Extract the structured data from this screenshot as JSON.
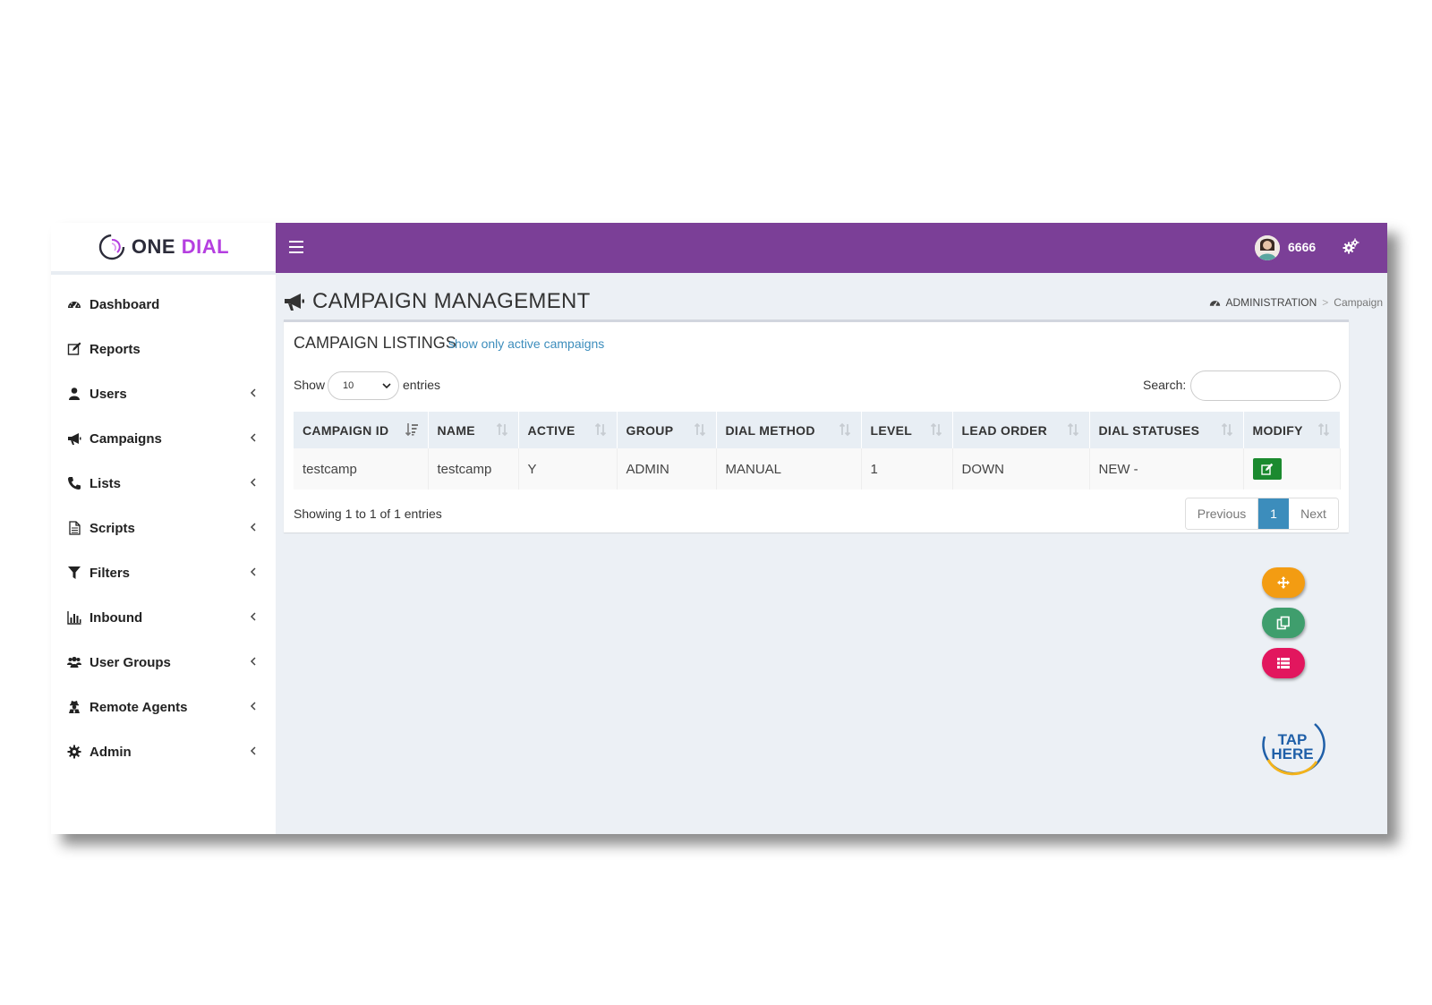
{
  "brand": {
    "one": "ONE",
    "dial": "DIAL"
  },
  "sidebar": {
    "items": [
      {
        "label": "Dashboard",
        "icon": "dashboard-icon",
        "has_children": false
      },
      {
        "label": "Reports",
        "icon": "edit-icon",
        "has_children": false
      },
      {
        "label": "Users",
        "icon": "user-icon",
        "has_children": true
      },
      {
        "label": "Campaigns",
        "icon": "bullhorn-icon",
        "has_children": true
      },
      {
        "label": "Lists",
        "icon": "phone-icon",
        "has_children": true
      },
      {
        "label": "Scripts",
        "icon": "file-icon",
        "has_children": true
      },
      {
        "label": "Filters",
        "icon": "filter-icon",
        "has_children": true
      },
      {
        "label": "Inbound",
        "icon": "bar-chart-icon",
        "has_children": true
      },
      {
        "label": "User Groups",
        "icon": "users-icon",
        "has_children": true
      },
      {
        "label": "Remote Agents",
        "icon": "user-secret-icon",
        "has_children": true
      },
      {
        "label": "Admin",
        "icon": "gear-icon",
        "has_children": true
      }
    ]
  },
  "topbar": {
    "user_name": "6666"
  },
  "page": {
    "title": "CAMPAIGN MANAGEMENT",
    "breadcrumb": {
      "root": "ADMINISTRATION",
      "separator": ">",
      "current": "Campaign"
    }
  },
  "box": {
    "title": "CAMPAIGN LISTINGS",
    "link": "show only active campaigns",
    "length_label_before": "Show",
    "length_value": "10",
    "length_label_after": "entries",
    "search_label": "Search:",
    "search_value": ""
  },
  "table": {
    "columns": [
      "CAMPAIGN ID",
      "NAME",
      "ACTIVE",
      "GROUP",
      "DIAL METHOD",
      "LEVEL",
      "LEAD ORDER",
      "DIAL STATUSES",
      "MODIFY"
    ],
    "rows": [
      {
        "campaign_id": "testcamp",
        "name": "testcamp",
        "active": "Y",
        "group": "ADMIN",
        "dial_method": "MANUAL",
        "level": "1",
        "lead_order": "DOWN",
        "dial_statuses": "NEW -"
      }
    ]
  },
  "pagination": {
    "info": "Showing 1 to 1 of 1 entries",
    "previous": "Previous",
    "current_page": "1",
    "next": "Next"
  },
  "floating_buttons": [
    {
      "icon": "arrows-icon",
      "color": "#f39c12"
    },
    {
      "icon": "copy-icon",
      "color": "#3f9e6d"
    },
    {
      "icon": "list-icon",
      "color": "#e2165e"
    }
  ],
  "tap_here": {
    "line1": "TAP",
    "line2": "HERE"
  },
  "colors": {
    "topbar": "#7b3f97",
    "brand_dial": "#b53fe0",
    "link": "#3c8dbc",
    "active_page": "#3c8dbc",
    "edit_button": "#1b8a2f"
  }
}
